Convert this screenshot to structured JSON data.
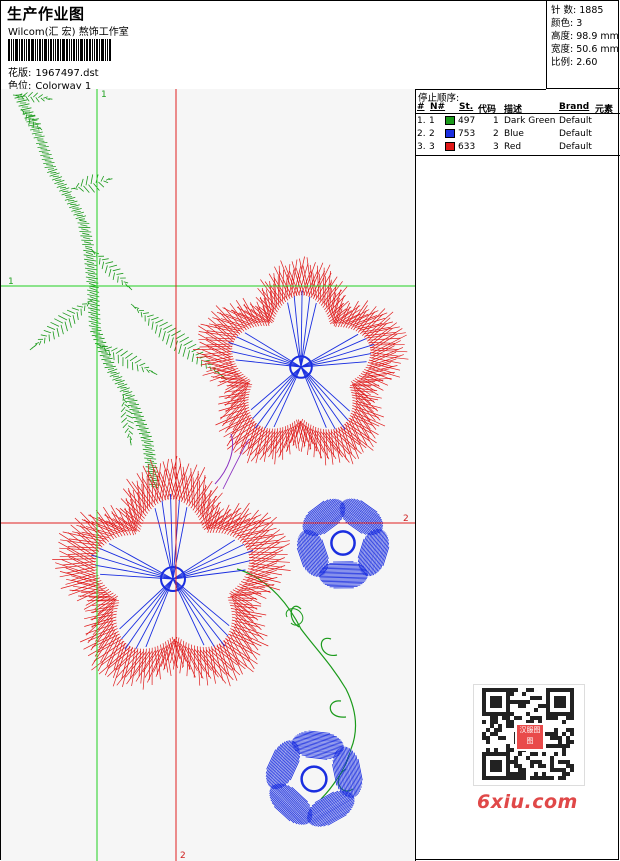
{
  "header": {
    "title": "生产作业图",
    "studio": "Wilcom(汇 宏) 熬饰工作室",
    "design_label": "花版:",
    "design_value": "1967497.dst",
    "colorway_label": "色位:",
    "colorway_value": "Colorway 1"
  },
  "stats": {
    "stitches": "针 数: 1885",
    "colors": "颜色: 3",
    "height": "高度: 98.9 mm",
    "width": "宽度: 50.6 mm",
    "scale": "比例: 2.60"
  },
  "stop_sequence": {
    "heading": "停止顺序:",
    "columns": [
      "#",
      "N#",
      "St.",
      "代码",
      "描述",
      "Brand",
      "元素"
    ],
    "rows": [
      {
        "num": "1.",
        "n": "1",
        "color": "#1a9a1a",
        "st": "497",
        "code": "1",
        "desc": "Dark Green",
        "brand": "Default"
      },
      {
        "num": "2.",
        "n": "2",
        "color": "#1a2ee0",
        "st": "753",
        "code": "2",
        "desc": "Blue",
        "brand": "Default"
      },
      {
        "num": "3.",
        "n": "3",
        "color": "#e01818",
        "st": "633",
        "code": "3",
        "desc": "Red",
        "brand": "Default"
      }
    ]
  },
  "guides": {
    "green_v": "1",
    "green_h": "1",
    "red_h": "2",
    "red_v": "2"
  },
  "thread_colors": {
    "green": "#1a9a1a",
    "blue": "#1a2ee0",
    "red": "#e01818"
  },
  "watermark": {
    "site": "6xiu.com",
    "badge": "汉服图图"
  }
}
